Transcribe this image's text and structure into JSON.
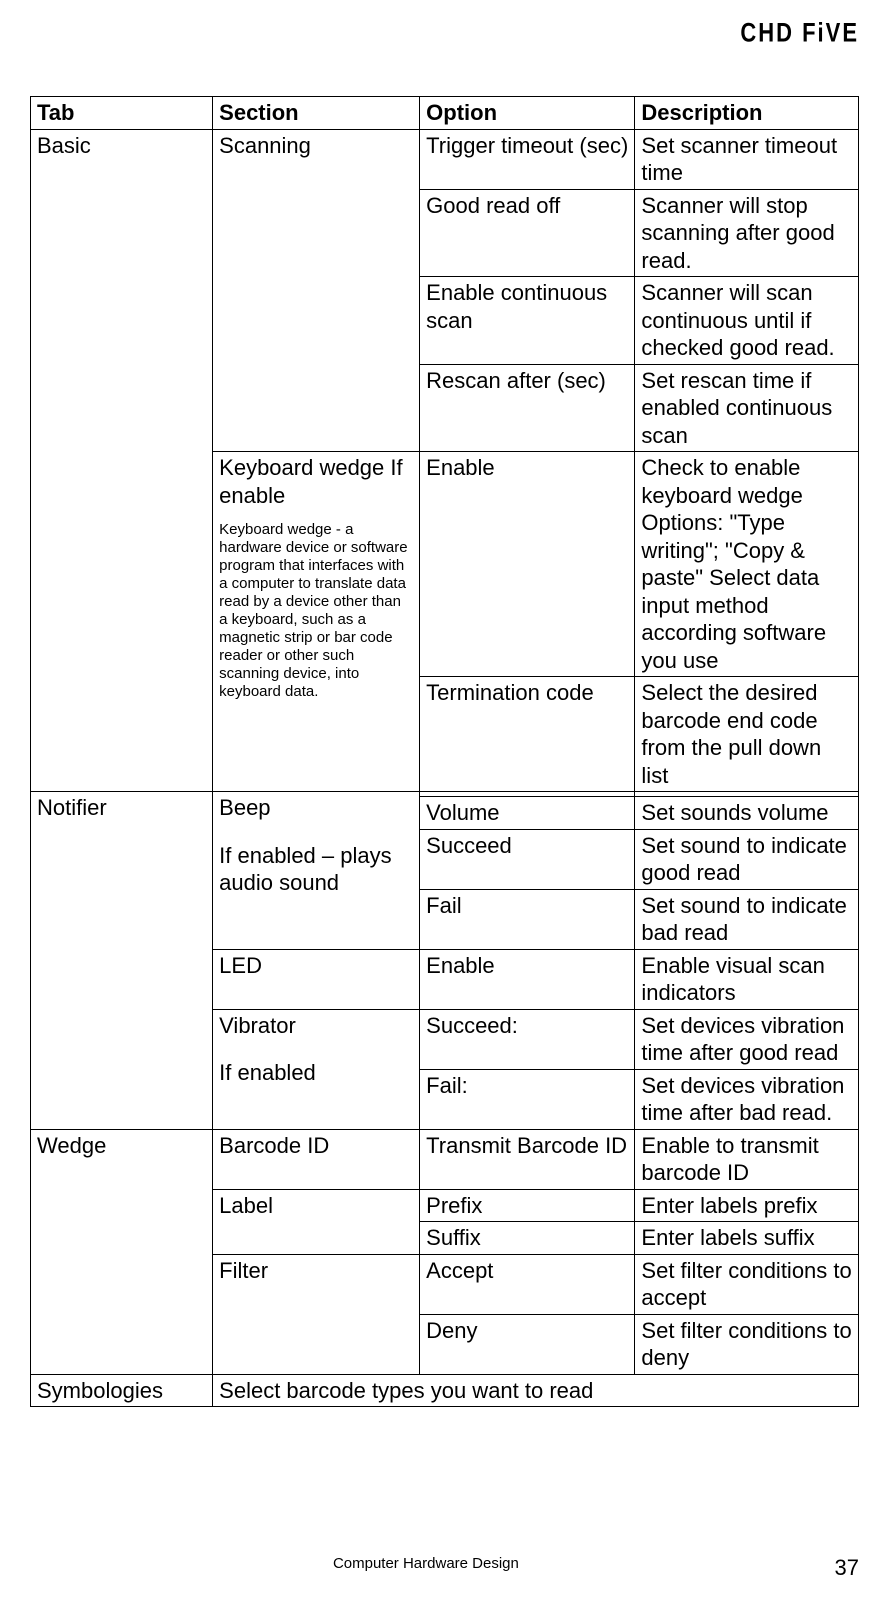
{
  "header": "CHD FiVE",
  "table": {
    "headers": [
      "Tab",
      "Section",
      "Option",
      "Description"
    ],
    "rows": [
      {
        "tab": "Basic",
        "section": "Scanning",
        "option": "Trigger timeout (sec)",
        "description": "Set scanner timeout time"
      },
      {
        "option": "Good read off",
        "description": "Scanner will stop scanning after good read."
      },
      {
        "option": "Enable continuous scan",
        "description": "Scanner will scan continuous until if checked good read."
      },
      {
        "option": "Rescan after (sec)",
        "description": "Set rescan time if enabled continuous scan"
      },
      {
        "section_main": "Keyboard wedge If enable",
        "section_note": "Keyboard wedge - a hardware device or software program that interfaces with a computer to translate data read by a device other than a keyboard, such as a magnetic strip or bar code reader or other such scanning device, into keyboard data.",
        "option": "Enable",
        "description": "Check to enable keyboard wedge Options:\n\"Type writing\"; \"Copy & paste\" Select data input method according software you use"
      },
      {
        "option": "Termination code",
        "description": "Select the desired barcode end code from the pull down list"
      },
      {
        "tab": "Notifier",
        "section_main": "Beep",
        "section_sub": "If enabled – plays audio sound",
        "option": "",
        "description": ""
      },
      {
        "option": "Volume",
        "description": "Set sounds volume"
      },
      {
        "option": "Succeed",
        "description": "Set sound to indicate good read"
      },
      {
        "option": "Fail",
        "description": "Set sound to indicate bad read"
      },
      {
        "section": "LED",
        "option": "Enable",
        "description": "Enable visual scan indicators"
      },
      {
        "section_main": "Vibrator",
        "section_sub": "If enabled",
        "option": "Succeed:",
        "description": "Set devices vibration time after good read"
      },
      {
        "option": "Fail:",
        "description": "Set devices vibration time after bad read."
      },
      {
        "tab": "Wedge",
        "section": "Barcode ID",
        "option": "Transmit Barcode ID",
        "description": "Enable to transmit barcode ID"
      },
      {
        "section": "Label",
        "option": "Prefix",
        "description": "Enter labels prefix"
      },
      {
        "option": "Suffix",
        "description": "Enter labels suffix"
      },
      {
        "section": "Filter",
        "option": "Accept",
        "description": "Set filter conditions to accept"
      },
      {
        "option": "Deny",
        "description": "Set filter conditions to deny"
      },
      {
        "tab": "Symbologies",
        "merged": "Select barcode types you want to read"
      }
    ]
  },
  "footer": {
    "center": "Computer Hardware Design",
    "page": "37"
  }
}
